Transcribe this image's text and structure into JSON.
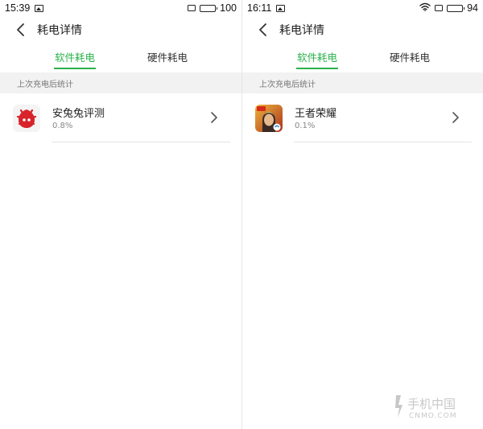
{
  "screens": [
    {
      "status": {
        "time": "15:39",
        "battery": "100",
        "wifi": false
      },
      "title": "耗电详情",
      "tabs": [
        {
          "label": "软件耗电",
          "active": true
        },
        {
          "label": "硬件耗电",
          "active": false
        }
      ],
      "section_label": "上次充电后统计",
      "apps": [
        {
          "name": "安兔兔评测",
          "usage": "0.8%",
          "icon": "antutu-icon"
        }
      ]
    },
    {
      "status": {
        "time": "16:11",
        "battery": "94",
        "wifi": true
      },
      "title": "耗电详情",
      "tabs": [
        {
          "label": "软件耗电",
          "active": true
        },
        {
          "label": "硬件耗电",
          "active": false
        }
      ],
      "section_label": "上次充电后统计",
      "apps": [
        {
          "name": "王者荣耀",
          "usage": "0.1%",
          "icon": "honor-of-kings-icon"
        }
      ]
    }
  ],
  "colors": {
    "accent": "#2bb24c",
    "section_bg": "#f2f2f2",
    "divider": "#e4e4e4"
  },
  "watermark": {
    "text": "手机中国",
    "subtext": "CNMO.COM"
  }
}
